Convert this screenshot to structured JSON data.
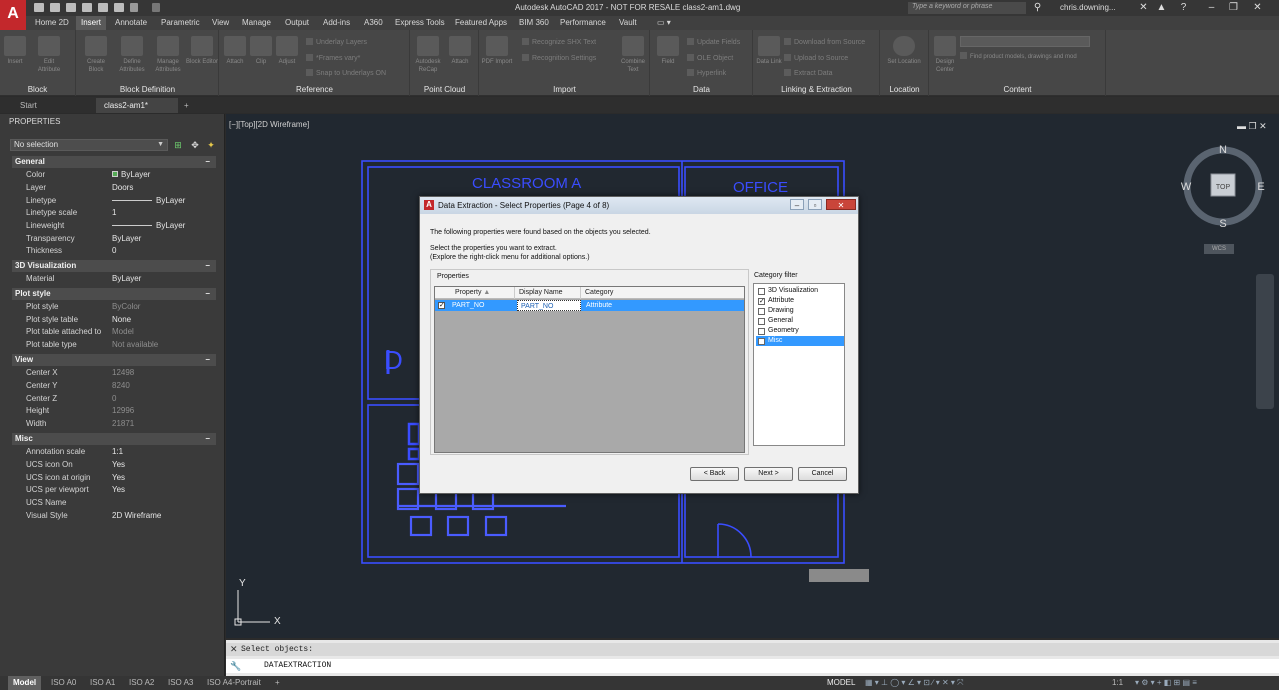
{
  "titlebar": {
    "title": "Autodesk AutoCAD 2017 - NOT FOR RESALE   class2-am1.dwg",
    "search_placeholder": "Type a keyword or phrase",
    "user": "chris.downing..."
  },
  "ribbon_tabs": [
    "Home 2D",
    "Insert",
    "Annotate",
    "Parametric",
    "View",
    "Manage",
    "Output",
    "Add-ins",
    "A360",
    "Express Tools",
    "Featured Apps",
    "BIM 360",
    "Performance",
    "Vault"
  ],
  "ribbon_active_tab": "Insert",
  "ribbon_panels": {
    "block": "Block",
    "block_definition": "Block Definition",
    "reference": "Reference",
    "point_cloud": "Point Cloud",
    "import": "Import",
    "data": "Data",
    "linking": "Linking & Extraction",
    "location": "Location",
    "content": "Content"
  },
  "ribbon_buttons": {
    "insert": "Insert",
    "edit_attribute": "Edit Attribute",
    "create_block": "Create Block",
    "define_attributes": "Define Attributes",
    "manage_attributes": "Manage Attributes",
    "block_editor": "Block Editor",
    "attach": "Attach",
    "clip": "Clip",
    "adjust": "Adjust",
    "underlay_layers": "Underlay Layers",
    "frames_vary": "*Frames vary*",
    "snap_to_underlays": "Snap to Underlays ON",
    "autodesk_recap": "Autodesk ReCap",
    "attach_pc": "Attach",
    "pdf_import": "PDF Import",
    "recognize_shx": "Recognize SHX Text",
    "recognition_settings": "Recognition Settings",
    "combine_text": "Combine Text",
    "field": "Field",
    "update_fields": "Update Fields",
    "ole_object": "OLE Object",
    "hyperlink": "Hyperlink",
    "data_link": "Data Link",
    "download_from_source": "Download from Source",
    "upload_to_source": "Upload to Source",
    "extract_data": "Extract  Data",
    "set_location": "Set Location",
    "design_center": "Design Center",
    "content_search": "Find product models, drawings and mod"
  },
  "file_tabs": [
    "Start",
    "class2-am1*"
  ],
  "properties": {
    "title": "PROPERTIES",
    "selection": "No selection",
    "sections": {
      "general": "General",
      "viz3d": "3D Visualization",
      "plot_style": "Plot style",
      "view": "View",
      "misc": "Misc"
    },
    "general": [
      {
        "k": "Color",
        "v": "ByLayer"
      },
      {
        "k": "Layer",
        "v": "Doors"
      },
      {
        "k": "Linetype",
        "v": "ByLayer"
      },
      {
        "k": "Linetype scale",
        "v": "1"
      },
      {
        "k": "Lineweight",
        "v": "ByLayer"
      },
      {
        "k": "Transparency",
        "v": "ByLayer"
      },
      {
        "k": "Thickness",
        "v": "0"
      }
    ],
    "viz3d": [
      {
        "k": "Material",
        "v": "ByLayer"
      }
    ],
    "plot_style": [
      {
        "k": "Plot style",
        "v": "ByColor"
      },
      {
        "k": "Plot style table",
        "v": "None"
      },
      {
        "k": "Plot table attached to",
        "v": "Model"
      },
      {
        "k": "Plot table type",
        "v": "Not available"
      }
    ],
    "view": [
      {
        "k": "Center X",
        "v": "12498"
      },
      {
        "k": "Center Y",
        "v": "8240"
      },
      {
        "k": "Center Z",
        "v": "0"
      },
      {
        "k": "Height",
        "v": "12996"
      },
      {
        "k": "Width",
        "v": "21871"
      }
    ],
    "misc": [
      {
        "k": "Annotation scale",
        "v": "1:1"
      },
      {
        "k": "UCS icon On",
        "v": "Yes"
      },
      {
        "k": "UCS icon at origin",
        "v": "Yes"
      },
      {
        "k": "UCS per viewport",
        "v": "Yes"
      },
      {
        "k": "UCS Name",
        "v": ""
      },
      {
        "k": "Visual Style",
        "v": "2D Wireframe"
      }
    ]
  },
  "viewport": {
    "label": "[−][Top][2D Wireframe]",
    "room1": "CLASSROOM  A",
    "room2": "OFFICE",
    "partial_text": "D",
    "wcs": "WCS",
    "ucs_x": "X",
    "ucs_y": "Y"
  },
  "viewcube": {
    "n": "N",
    "s": "S",
    "e": "E",
    "w": "W",
    "top": "TOP"
  },
  "dialog": {
    "title": "Data Extraction - Select Properties (Page 4 of 8)",
    "line1": "The following properties were found based on the objects you selected.",
    "line2": "Select the properties you want to extract.",
    "line3": "(Explore the right-click menu for additional options.)",
    "properties_label": "Properties",
    "columns": [
      "Property",
      "Display Name",
      "Category"
    ],
    "rows": [
      {
        "property": "PART_NO",
        "display": "PART_NO",
        "category": "Attribute",
        "checked": "✓"
      }
    ],
    "category_label": "Category filter",
    "categories": [
      {
        "name": "3D Visualization",
        "check": ""
      },
      {
        "name": "Attribute",
        "check": "✓"
      },
      {
        "name": "Drawing",
        "check": ""
      },
      {
        "name": "General",
        "check": ""
      },
      {
        "name": "Geometry",
        "check": ""
      },
      {
        "name": "Misc",
        "check": ""
      }
    ],
    "back": "< Back",
    "next": "Next >",
    "cancel": "Cancel"
  },
  "command": {
    "history": "Select objects:",
    "current": "DATAEXTRACTION"
  },
  "layout_tabs": [
    "Model",
    "ISO A0",
    "ISO A1",
    "ISO A2",
    "ISO A3",
    "ISO A4-Portrait"
  ],
  "status": {
    "model": "MODEL",
    "scale": "1:1"
  },
  "colors": {
    "accent": "#3399ff",
    "drawing_blue": "#3a4dff",
    "autodesk_red": "#c3282c"
  }
}
